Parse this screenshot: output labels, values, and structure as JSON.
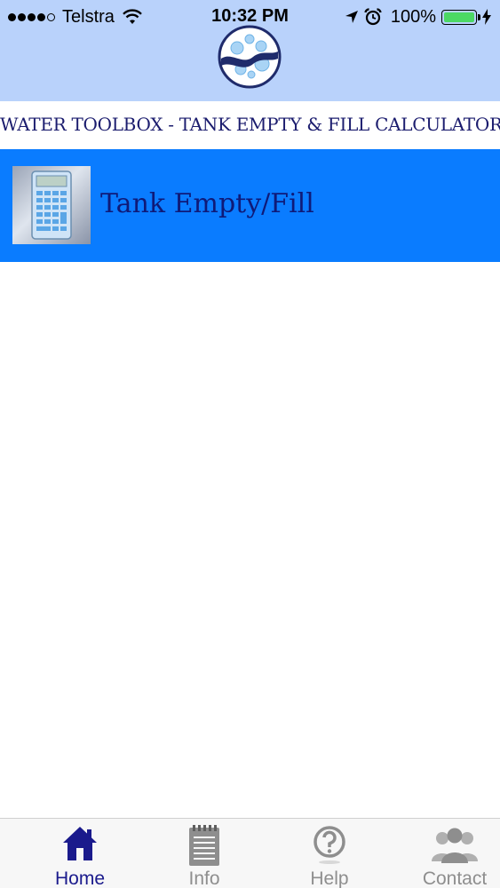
{
  "status_bar": {
    "carrier": "Telstra",
    "time": "10:32 PM",
    "battery_percent": "100%",
    "signal_icon": "signal-dots-icon",
    "wifi_icon": "wifi-icon",
    "location_icon": "location-arrow-icon",
    "alarm_icon": "alarm-clock-icon",
    "battery_icon": "battery-icon",
    "charging_icon": "charging-bolt-icon"
  },
  "header": {
    "logo_icon": "water-bubbles-logo-icon",
    "title": "WATER TOOLBOX - TANK EMPTY & FILL CALCULATOR"
  },
  "menu": {
    "items": [
      {
        "label": "Tank Empty/Fill",
        "icon": "calculator-icon"
      }
    ]
  },
  "tab_bar": {
    "tabs": [
      {
        "label": "Home",
        "icon": "home-icon",
        "active": true
      },
      {
        "label": "Info",
        "icon": "notepad-icon",
        "active": false
      },
      {
        "label": "Help",
        "icon": "question-circle-icon",
        "active": false
      },
      {
        "label": "Contact",
        "icon": "people-icon",
        "active": false
      }
    ]
  },
  "colors": {
    "header_bg": "#b9d2fb",
    "menu_row_bg": "#0a7cff",
    "title_text": "#1b1c6e",
    "active_tab": "#1a1a8c",
    "inactive_tab": "#8e8e8e",
    "battery_fill": "#4cd964"
  }
}
